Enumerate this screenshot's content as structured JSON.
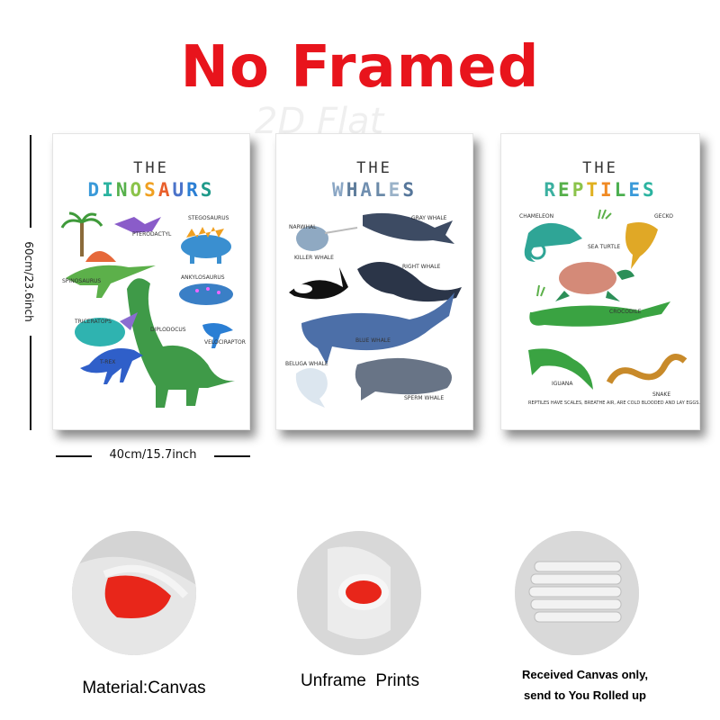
{
  "headline": "No Framed",
  "watermark": "2D Flat",
  "dimensions": {
    "height": "60cm/23.6inch",
    "width": "40cm/15.7inch"
  },
  "posters": [
    {
      "the": "THE",
      "title": "DINOSAURS",
      "title_colors": [
        "#3a9ad9",
        "#2bb3a0",
        "#56b04a",
        "#8bc34a",
        "#f0a020",
        "#e95f2b",
        "#4b73c9",
        "#2b7fd4",
        "#1f9a8a"
      ],
      "labels": [
        "PTERODACTYL",
        "STEGOSAURUS",
        "SPINOSAURUS",
        "ANKYLOSAURUS",
        "TRICERATOPS",
        "DIPLODOCUS",
        "VELOCIRAPTOR",
        "T-REX"
      ]
    },
    {
      "the": "THE",
      "title": "WHALES",
      "title_colors": [
        "#8aa6c4",
        "#5f7d9c",
        "#708fb0",
        "#6b8aa8",
        "#9ab2c8",
        "#56769a"
      ],
      "labels": [
        "NARWHAL",
        "GRAY WHALE",
        "KILLER WHALE",
        "RIGHT WHALE",
        "BLUE WHALE",
        "BELUGA WHALE",
        "SPERM WHALE"
      ]
    },
    {
      "the": "THE",
      "title": "REPTILES",
      "title_colors": [
        "#3bb0a0",
        "#56b04a",
        "#8bc34a",
        "#e0b020",
        "#f08a24",
        "#4caf50",
        "#3a9ad9",
        "#2bb3a0"
      ],
      "labels": [
        "CHAMELEON",
        "GECKO",
        "SEA TURTLE",
        "CROCODILE",
        "IGUANA",
        "SNAKE"
      ],
      "footnote": "REPTILES HAVE SCALES, BREATHE AIR, ARE COLD BLOODED AND LAY EGGS."
    }
  ],
  "features": [
    {
      "caption": "Material:Canvas"
    },
    {
      "caption": "Unframe  Prints"
    },
    {
      "caption_line1": "Received Canvas only,",
      "caption_line2": "send to You Rolled up"
    }
  ],
  "colors": {
    "headline": "#e8141c",
    "canvas_core": "#e8261a"
  }
}
